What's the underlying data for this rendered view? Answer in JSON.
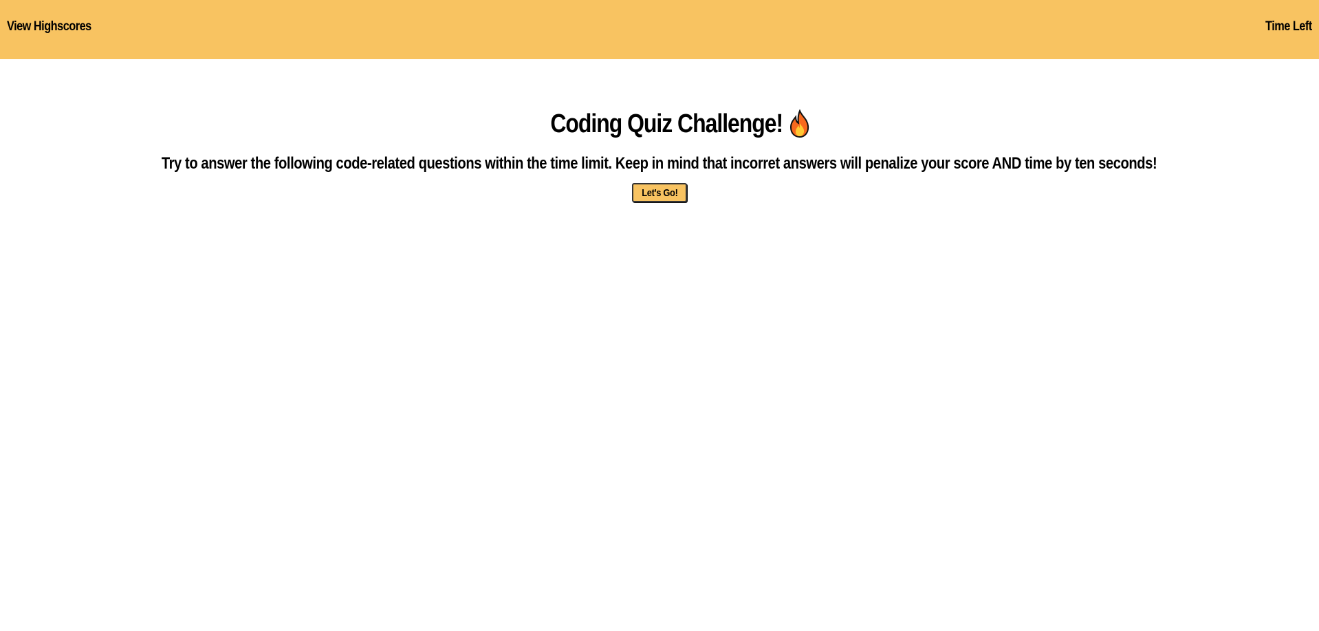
{
  "header": {
    "view_highscores": "View Highscores",
    "time_left": "Time Left"
  },
  "main": {
    "title": "Coding Quiz Challenge!",
    "title_icon": "fire-icon",
    "description": "Try to answer the following code-related questions within the time limit. Keep in mind that incorret answers will penalize your score AND time by ten seconds!",
    "start_button_label": "Let's Go!"
  },
  "colors": {
    "header_bg": "#f8c361",
    "button_bg": "#f8c361",
    "text": "#000000",
    "page_bg": "#ffffff"
  }
}
